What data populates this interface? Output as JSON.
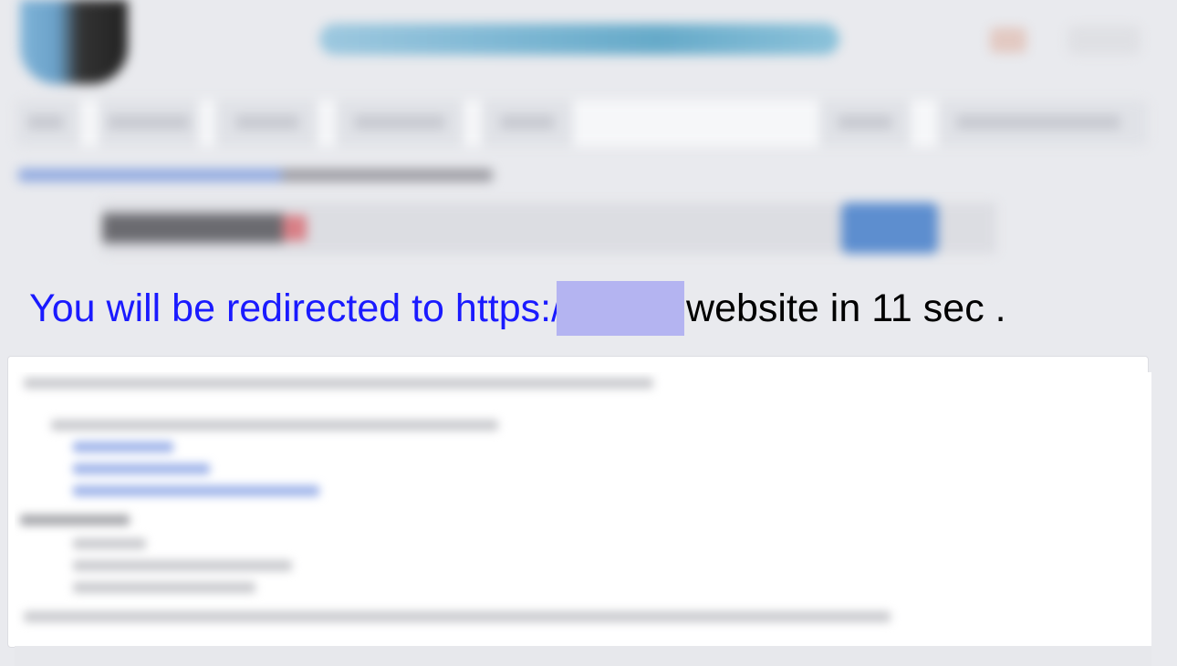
{
  "redirect": {
    "lead_text": "You will be redirected to https:/",
    "redacted_label": "",
    "tail_text": "website in 11 sec ."
  },
  "colors": {
    "page_background": "#e9eaee",
    "redirect_link_text": "#1a1aff",
    "redaction_box": "#b4b4f1",
    "card_background": "#ffffff"
  },
  "icons": {
    "site_logo": "logo-icon",
    "search": "search-bar",
    "account": "user-icon"
  }
}
